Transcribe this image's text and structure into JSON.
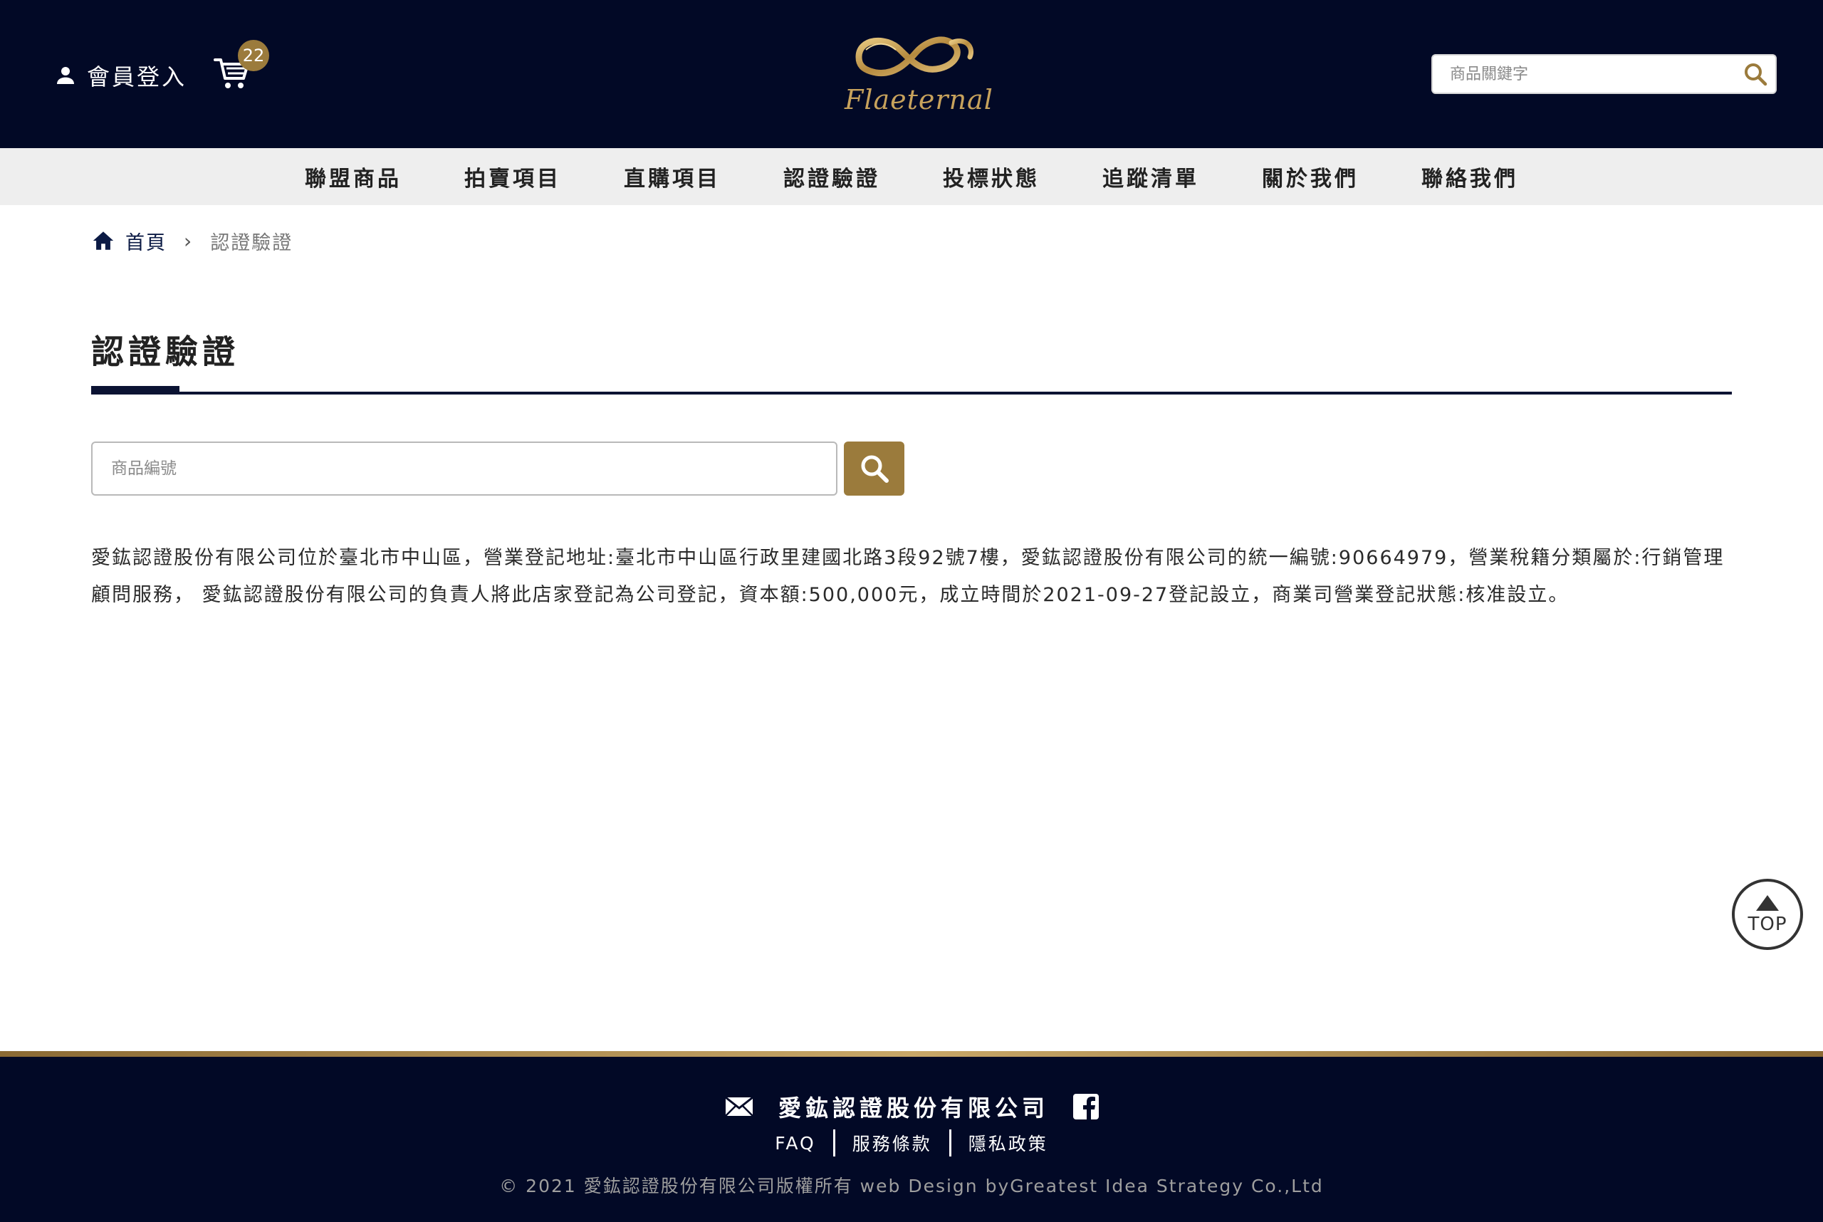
{
  "header": {
    "login_label": "會員登入",
    "cart_count": "22",
    "logo_text": "Flaeternal",
    "search_placeholder": "商品關鍵字"
  },
  "nav": {
    "items": [
      {
        "label": "聯盟商品"
      },
      {
        "label": "拍賣項目"
      },
      {
        "label": "直購項目"
      },
      {
        "label": "認證驗證"
      },
      {
        "label": "投標狀態"
      },
      {
        "label": "追蹤清單"
      },
      {
        "label": "關於我們"
      },
      {
        "label": "聯絡我們"
      }
    ]
  },
  "breadcrumb": {
    "home": "首頁",
    "separator": "›",
    "current": "認證驗證"
  },
  "main": {
    "title": "認證驗證",
    "search_placeholder": "商品編號",
    "description": "愛鈜認證股份有限公司位於臺北市中山區，營業登記地址:臺北市中山區行政里建國北路3段92號7樓，愛鈜認證股份有限公司的統一編號:90664979，營業稅籍分類屬於:行銷管理顧問服務， 愛鈜認證股份有限公司的負責人將此店家登記為公司登記，資本額:500,000元，成立時間於2021-09-27登記設立，商業司營業登記狀態:核准設立。"
  },
  "top_button": {
    "label": "TOP"
  },
  "footer": {
    "company": "愛鈜認證股份有限公司",
    "links": [
      {
        "label": "FAQ"
      },
      {
        "label": "服務條款"
      },
      {
        "label": "隱私政策"
      }
    ],
    "copyright": "© 2021 愛鈜認證股份有限公司版權所有 web Design byGreatest Idea Strategy Co.,Ltd"
  },
  "colors": {
    "header_bg": "#020926",
    "accent_gold": "#9b7b3c",
    "nav_bg": "#eeeeee"
  },
  "icons": [
    "user-icon",
    "cart-icon",
    "search-icon",
    "home-icon",
    "chevron-right-icon",
    "mail-icon",
    "facebook-icon",
    "arrow-up-icon"
  ]
}
